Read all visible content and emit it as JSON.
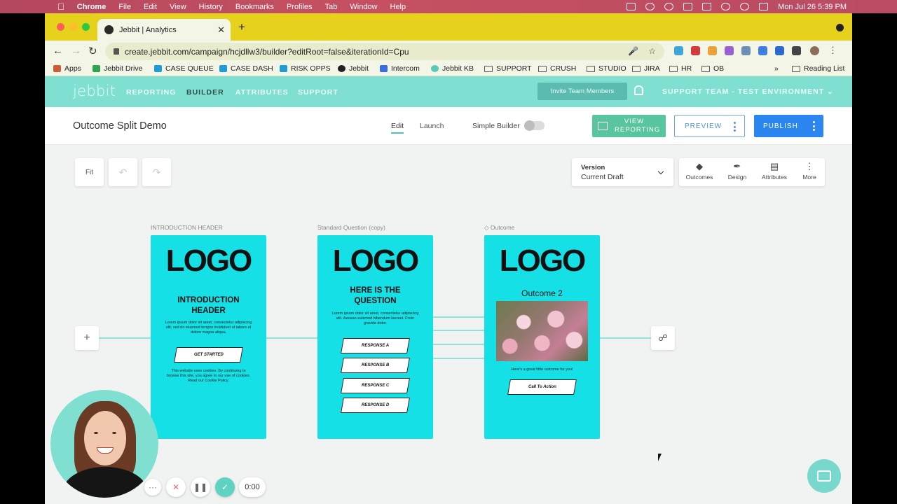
{
  "menubar": {
    "app": "Chrome",
    "items": [
      "File",
      "Edit",
      "View",
      "History",
      "Bookmarks",
      "Profiles",
      "Tab",
      "Window",
      "Help"
    ],
    "clock": "Mon Jul 26  5:39 PM"
  },
  "browser": {
    "tab_title": "Jebbit | Analytics",
    "url": "create.jebbit.com/campaign/hcjdllw3/builder?editRoot=false&iterationId=Cpu",
    "bookmarks": [
      "Apps",
      "Jebbit Drive",
      "CASE QUEUE",
      "CASE DASH",
      "RISK OPPS",
      "Jebbit",
      "Intercom",
      "Jebbit KB",
      "SUPPORT",
      "CRUSH",
      "STUDIO",
      "JIRA",
      "HR",
      "OB"
    ],
    "reading_list": "Reading List"
  },
  "app": {
    "logo": "jebbit",
    "nav": [
      "REPORTING",
      "BUILDER",
      "ATTRIBUTES",
      "SUPPORT"
    ],
    "invite_label": "Invite Team Members",
    "team": "SUPPORT TEAM - TEST ENVIRONMENT"
  },
  "subheader": {
    "title": "Outcome Split Demo",
    "modes": [
      "Edit",
      "Launch"
    ],
    "simple_builder": "Simple Builder",
    "view_reporting": "VIEW REPORTING",
    "preview": "PREVIEW",
    "publish": "PUBLISH"
  },
  "canvas_tools": {
    "fit": "Fit",
    "version_label": "Version",
    "version_value": "Current Draft",
    "right_tools": [
      "Outcomes",
      "Design",
      "Attributes",
      "More"
    ]
  },
  "cards": [
    {
      "label": "INTRODUCTION HEADER",
      "logo": "LOGO",
      "heading": "INTRODUCTION HEADER",
      "body": "Lorem ipsum dolor sit amet, consectetur adipiscing elit, sed do eiusmod tempor incididunt ut labore et dolore magna aliqua.",
      "button": "GET STARTED",
      "footer": "This website uses cookies. By continuing to browse this site, you agree to our use of cookies. Read our Cookie Policy."
    },
    {
      "label": "Standard Question (copy)",
      "logo": "LOGO",
      "heading": "HERE IS THE QUESTION",
      "body": "Lorem ipsum dolor sit amet, consectetur adipiscing elit. Aenean euismod bibendum laoreet. Proin gravida dolor.",
      "responses": [
        "RESPONSE A",
        "RESPONSE B",
        "RESPONSE C",
        "RESPONSE D"
      ]
    },
    {
      "label": "Outcome",
      "logo": "LOGO",
      "heading": "Outcome 2",
      "body": "Here's a great little outcome for you!",
      "button": "Call To Action"
    }
  ],
  "recorder": {
    "timer": "0:00"
  }
}
